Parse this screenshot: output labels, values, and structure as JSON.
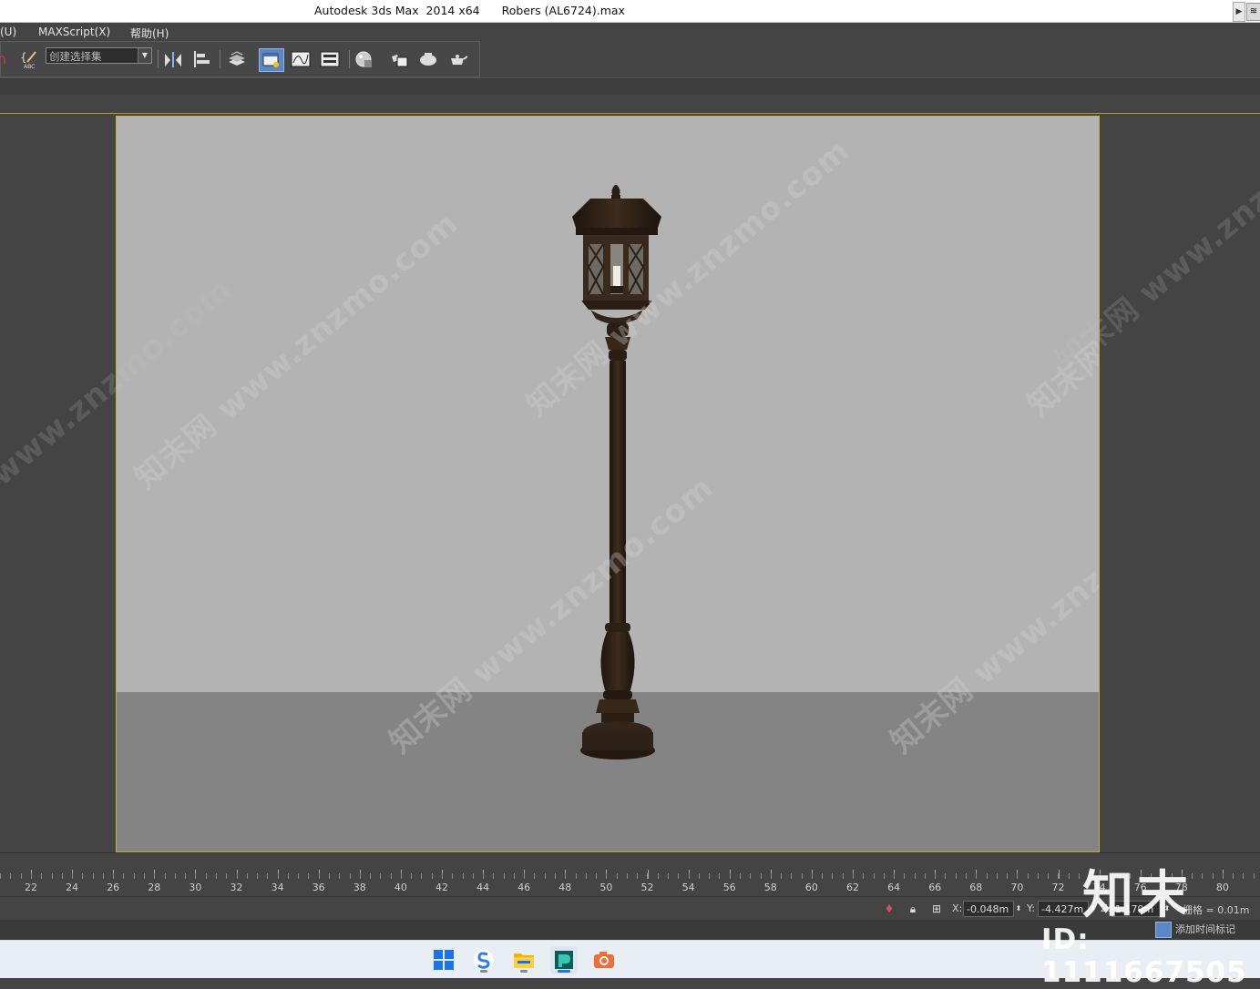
{
  "titlebar": {
    "app_title": "Autodesk 3ds Max  2014 x64",
    "file_title": "Robers (AL6724).max"
  },
  "menubar": {
    "items": [
      "(U)",
      "MAXScript(X)",
      "帮助(H)"
    ]
  },
  "toolbar": {
    "selection_set_value": "创建选择集",
    "icons": [
      "edit-named-selection-icon",
      "mirror-icon",
      "align-icon",
      "layer-manager-icon",
      "scene-explorer-icon",
      "curve-editor-icon",
      "schematic-view-icon",
      "material-editor-icon",
      "render-setup-icon",
      "rendered-frame-window-icon",
      "render-production-icon",
      "render-iterative-icon"
    ]
  },
  "viewport": {
    "watermarks": [
      "知末网 www.znzmo.com"
    ]
  },
  "timeline": {
    "ticks": [
      22,
      24,
      26,
      28,
      30,
      32,
      34,
      36,
      38,
      40,
      42,
      44,
      46,
      48,
      50,
      52,
      54,
      56,
      58,
      60,
      62,
      64,
      66,
      68,
      70,
      72,
      74,
      76,
      78,
      80
    ]
  },
  "statusbar": {
    "x_label": "X:",
    "x_value": "-0.048m",
    "y_label": "Y:",
    "y_value": "-4.427m",
    "z_label": "Z:",
    "z_value": "1.179m",
    "grid_text": "栅格 = 0.01m",
    "add_time_tag": "添加时间标记"
  },
  "taskbar": {
    "apps": [
      "windows-start-icon",
      "sogou-browser-icon",
      "file-explorer-icon",
      "3ds-max-icon",
      "screenshot-tool-icon"
    ]
  },
  "overlay": {
    "logo_text": "知末",
    "id_text": "ID: 1111667505"
  }
}
